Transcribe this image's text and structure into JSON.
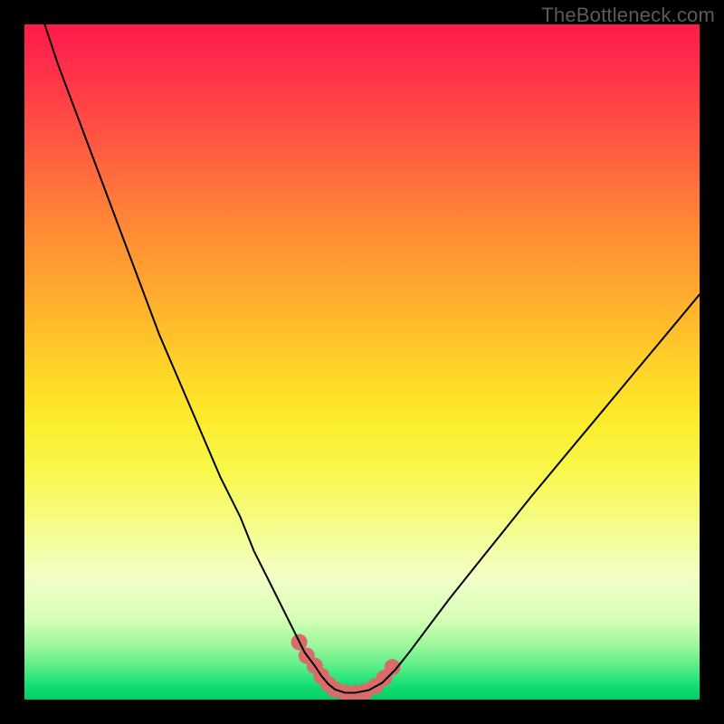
{
  "watermark": "TheBottleneck.com",
  "chart_data": {
    "type": "line",
    "title": "",
    "xlabel": "",
    "ylabel": "",
    "xlim": [
      0,
      100
    ],
    "ylim": [
      0,
      100
    ],
    "grid": false,
    "legend": false,
    "series": [
      {
        "name": "bottleneck-curve",
        "color": "#000000",
        "stroke_width": 2,
        "x": [
          3,
          5,
          8,
          11,
          14,
          17,
          20,
          23,
          26,
          29,
          32,
          34,
          36,
          38,
          40,
          41.5,
          43,
          44,
          45,
          46,
          47.5,
          49,
          51,
          53,
          55,
          57,
          60,
          63,
          67,
          71,
          75,
          80,
          85,
          90,
          95,
          100
        ],
        "values": [
          100,
          94,
          86,
          78,
          70,
          62,
          54,
          47,
          40,
          33,
          27,
          22,
          18,
          14,
          10,
          7,
          5,
          3.5,
          2.3,
          1.5,
          1.0,
          1.0,
          1.4,
          2.5,
          4.5,
          7,
          11,
          15,
          20,
          25,
          30,
          36,
          42,
          48,
          54,
          60
        ]
      },
      {
        "name": "highlight-markers",
        "color": "#d96b6b",
        "marker_radius": 9,
        "x": [
          40.7,
          41.8,
          43.0,
          44.0,
          45.0,
          46.0,
          47.5,
          49.0,
          50.5,
          52.0,
          53.3,
          54.5
        ],
        "values": [
          8.5,
          6.5,
          5.0,
          3.5,
          2.3,
          1.5,
          1.0,
          1.0,
          1.2,
          2.0,
          3.2,
          4.8
        ]
      }
    ]
  }
}
